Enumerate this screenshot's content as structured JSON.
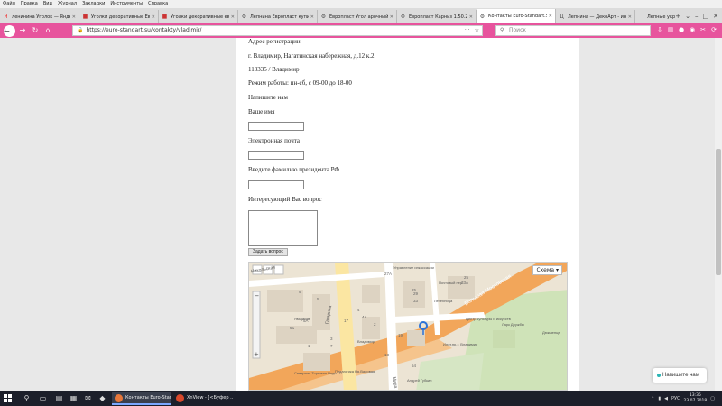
{
  "menu": [
    "Файл",
    "Правка",
    "Вид",
    "Журнал",
    "Закладки",
    "Инструменты",
    "Справка"
  ],
  "tabs": [
    {
      "label": "ленинина Уголок — Яндекс",
      "icon": "Я",
      "color": "#e33"
    },
    {
      "label": "Уголки декоративные Евр",
      "icon": "■",
      "color": "#c33"
    },
    {
      "label": "Уголки декоративные евр",
      "icon": "■",
      "color": "#c33"
    },
    {
      "label": "Лепнина Европласт купит",
      "icon": "⚙",
      "color": "#555"
    },
    {
      "label": "Европласт Угол арочный",
      "icon": "⚙",
      "color": "#555"
    },
    {
      "label": "Европласт Карниз 1.50.21",
      "icon": "⚙",
      "color": "#555"
    },
    {
      "label": "Контакты Euro-Standart.Su",
      "icon": "⚙",
      "color": "#555",
      "active": true
    },
    {
      "label": "Лепнина — ДекоАрт - интер",
      "icon": "Д",
      "color": "#555"
    },
    {
      "label": "Лепные украшения из пол",
      "icon": "",
      "color": "#555"
    }
  ],
  "url": "https://euro-standart.su/kontakty/vladimir/",
  "search_placeholder": "Поиск",
  "page": {
    "address_heading": "Адрес регистрации",
    "address": "г. Владимир, Нагатинская набережная, д.12 к.2",
    "postal": "113335 / Владимир",
    "hours": "Режим работы: пн-сб, с 09-00 до 18-00",
    "form_title": "Напишите нам",
    "name_label": "Ваше имя",
    "email_label": "Электронная почта",
    "president_label": "Введите фамилию президента РФ",
    "question_label": "Интересующий Вас вопрос",
    "submit_label": "Задать вопрос"
  },
  "map": {
    "scheme_label": "Схема ▾",
    "streets": [
      "Большая Московская",
      "Гагарина",
      "Никольская",
      "Мира"
    ],
    "labels": [
      "Управление инкассации",
      "Почтовый пер.",
      "Лечебница",
      "Владимир",
      "Центр культуры и искусств",
      "Илот.пр-т, Владимир",
      "Ларк Дружбы",
      "Дюкшенце",
      "Северная Торговая Ряды",
      "Андрей Губкин",
      "Педагогика Ня.Валовая",
      "Ямщиков"
    ],
    "numbers": [
      "27А",
      "25",
      "33А",
      "29",
      "33",
      "9",
      "5",
      "4",
      "17",
      "5А",
      "4А",
      "2",
      "19",
      "3",
      "7",
      "13",
      "5а",
      "1",
      "25",
      "54"
    ]
  },
  "chat_label": "Напишите нам",
  "taskbar": {
    "apps": [
      {
        "label": "Контакты Euro-Stan",
        "color": "#e8773a"
      },
      {
        "label": "XnView - [<Буфер ...",
        "color": "#d9482b"
      }
    ],
    "lang": "РУС",
    "time": "13:35",
    "date": "23.07.2018"
  }
}
